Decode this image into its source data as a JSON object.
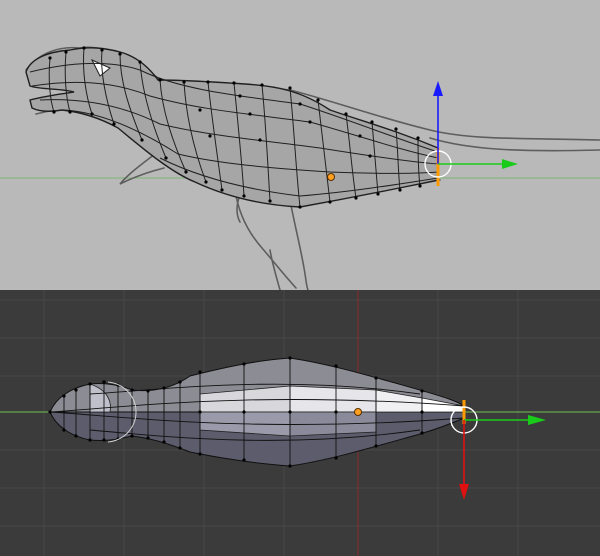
{
  "colors": {
    "side_background": "#b9b9b9",
    "top_background": "#3b3b3b",
    "grid_line": "#474747",
    "x_axis": "#6fbf4f",
    "y_axis_red": "#8b2b2b",
    "gizmo_z": "#1a1aff",
    "gizmo_y": "#1acc1a",
    "gizmo_x": "#e01010",
    "selected_edge": "#ff9a00",
    "vertex": "#000000",
    "origin": "#ffa020"
  },
  "viewports": [
    {
      "id": "side",
      "name": "side-view",
      "gizmo_axes": [
        "z-arrow",
        "y-arrow"
      ]
    },
    {
      "id": "top",
      "name": "top-view",
      "gizmo_axes": [
        "y-arrow",
        "x-arrow"
      ]
    }
  ],
  "icons": [
    "transform-gizmo-icon",
    "object-origin-icon",
    "reference-sketch-icon"
  ]
}
